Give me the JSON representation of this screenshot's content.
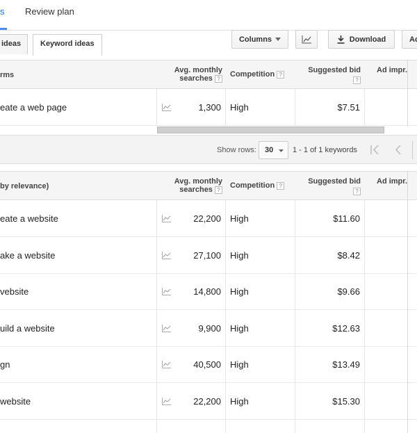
{
  "top_tabs": [
    {
      "label": "s",
      "active": true
    },
    {
      "label": "Review plan",
      "active": false
    }
  ],
  "subtabs": {
    "ad_group": "ideas",
    "keyword": "Keyword ideas"
  },
  "toolbar": {
    "columns": "Columns",
    "download": "Download",
    "add_partial": "Ad"
  },
  "table1": {
    "col_term": "rms",
    "col_searches_1": "Avg. monthly",
    "col_searches_2": "searches",
    "col_competition": "Competition",
    "col_bid": "Suggested bid",
    "col_adimpr": "Ad impr.",
    "help": "?",
    "rows": [
      {
        "keyword": "eate a web page",
        "searches": "1,300",
        "competition": "High",
        "bid": "$7.51"
      }
    ]
  },
  "pagination": {
    "show_rows_label": "Show rows:",
    "rows_value": "30",
    "range_text": "1 - 1 of 1 keywords"
  },
  "table2": {
    "col_term": "by relevance)",
    "col_searches_1": "Avg. monthly",
    "col_searches_2": "searches",
    "col_competition": "Competition",
    "col_bid": "Suggested bid",
    "col_adimpr": "Ad impr.",
    "help": "?",
    "rows": [
      {
        "keyword": "eate a website",
        "searches": "22,200",
        "competition": "High",
        "bid": "$11.60"
      },
      {
        "keyword": "ake a website",
        "searches": "27,100",
        "competition": "High",
        "bid": "$8.42"
      },
      {
        "keyword": "vebsite",
        "searches": "14,800",
        "competition": "High",
        "bid": "$9.66"
      },
      {
        "keyword": "uild a website",
        "searches": "9,900",
        "competition": "High",
        "bid": "$12.63"
      },
      {
        "keyword": "gn",
        "searches": "40,500",
        "competition": "High",
        "bid": "$13.49"
      },
      {
        "keyword": "website",
        "searches": "22,200",
        "competition": "High",
        "bid": "$15.30"
      }
    ]
  }
}
